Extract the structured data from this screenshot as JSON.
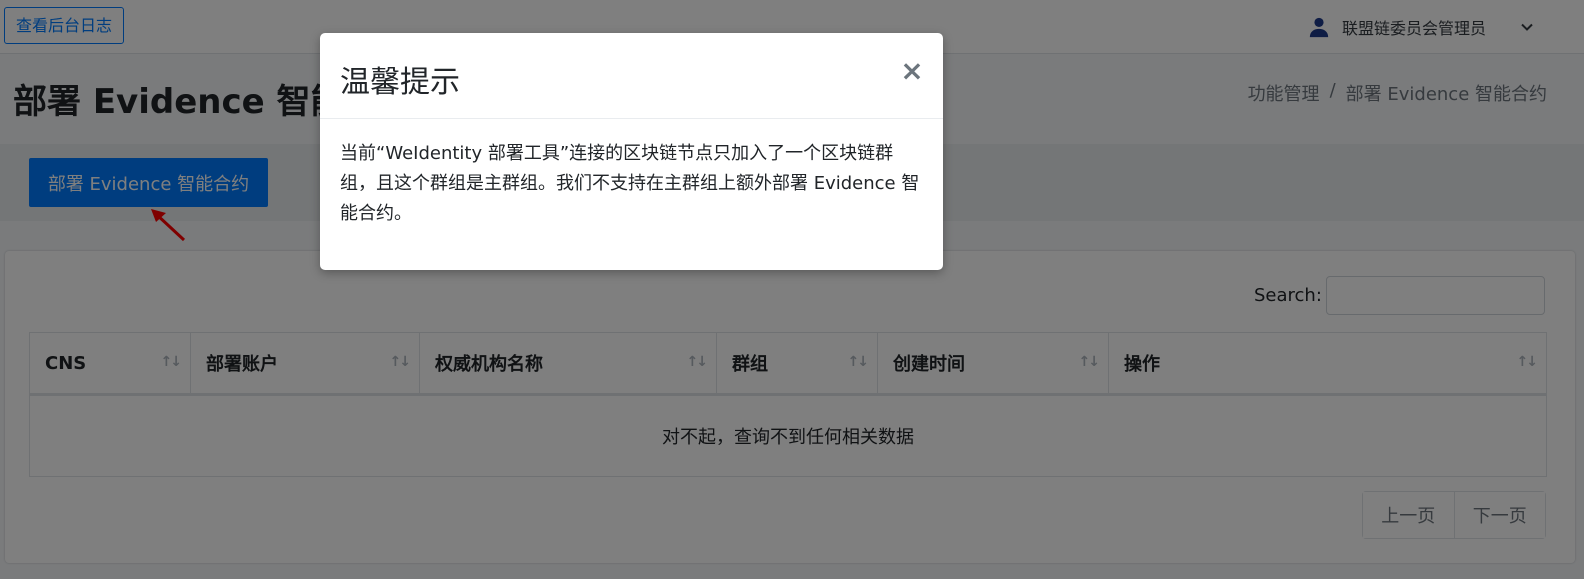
{
  "navbar": {
    "log_button": "查看后台日志",
    "user_name": "联盟链委员会管理员"
  },
  "header": {
    "title": "部署 Evidence 智能合约",
    "breadcrumb": [
      "功能管理",
      "/",
      "部署 Evidence 智能合约"
    ]
  },
  "actions": {
    "deploy_button": "部署 Evidence 智能合约"
  },
  "table": {
    "search_label": "Search:",
    "search_value": "",
    "columns": [
      "CNS",
      "部署账户",
      "权威机构名称",
      "群组",
      "创建时间",
      "操作"
    ],
    "sort_icons": [
      "↑↓",
      "↑↓",
      "↑↓",
      "↑↓",
      "↑↓",
      "↑↓"
    ],
    "empty_message": "对不起，查询不到任何相关数据"
  },
  "pagination": {
    "prev": "上一页",
    "next": "下一页"
  },
  "modal": {
    "title": "温馨提示",
    "close": "×",
    "body": "当前“WeIdentity 部署工具”连接的区块链节点只加入了一个区块链群组，且这个群组是主群组。我们不支持在主群组上额外部署 Evidence 智能合约。"
  },
  "icons": {
    "user": "user-icon",
    "dropdown": "chevron-down-icon",
    "annotation": "red-arrow-icon"
  },
  "colors": {
    "primary": "#007bff",
    "annotation_arrow": "#ff0000",
    "overlay": "rgba(0,0,0,0.5)"
  }
}
